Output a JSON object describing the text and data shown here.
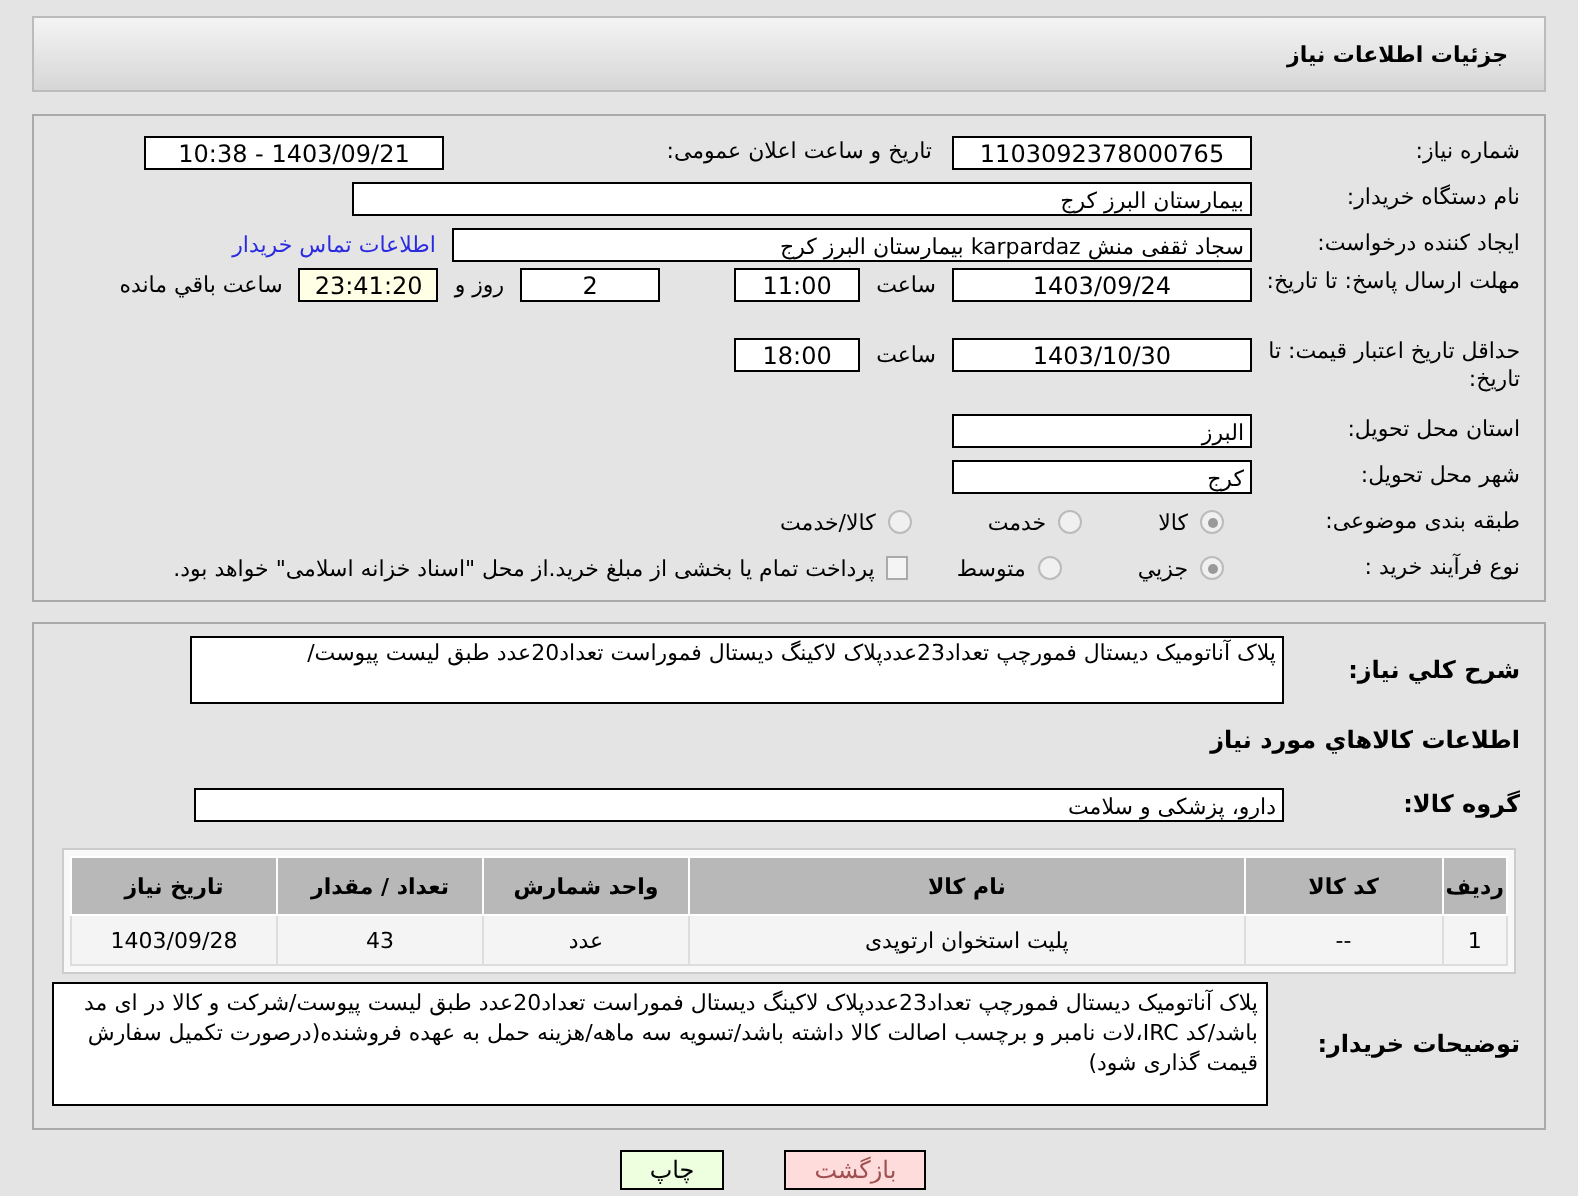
{
  "header": {
    "title": "جزئیات اطلاعات نیاز"
  },
  "need_number": {
    "label": "شماره نیاز:",
    "value": "1103092378000765"
  },
  "announce": {
    "label": "تاریخ و ساعت اعلان عمومی:",
    "value": "1403/09/21 - 10:38"
  },
  "buyer_org": {
    "label": "نام دستگاه خریدار:",
    "value": "بیمارستان البرز کرج"
  },
  "requester": {
    "label": "ایجاد کننده درخواست:",
    "value": "سجاد ثقفی منش karpardaz بیمارستان البرز کرج",
    "link": "اطلاعات تماس خریدار"
  },
  "reply_deadline": {
    "label": "مهلت ارسال پاسخ: تا تاریخ:",
    "date": "1403/09/24",
    "time_label": "ساعت",
    "time": "11:00",
    "days": "2",
    "days_label": "روز و",
    "remaining": "23:41:20",
    "remaining_label": "ساعت باقي مانده"
  },
  "price_validity": {
    "label": "حداقل تاریخ اعتبار قیمت: تا تاریخ:",
    "date": "1403/10/30",
    "time_label": "ساعت",
    "time": "18:00"
  },
  "province": {
    "label": "استان محل تحویل:",
    "value": "البرز"
  },
  "city": {
    "label": "شهر محل تحویل:",
    "value": "کرج"
  },
  "category": {
    "label": "طبقه بندی موضوعی:",
    "options": [
      {
        "label": "کالا",
        "selected": true
      },
      {
        "label": "خدمت",
        "selected": false
      },
      {
        "label": "کالا/خدمت",
        "selected": false
      }
    ]
  },
  "purchase_type": {
    "label": "نوع فرآیند خرید :",
    "options": [
      {
        "label": "جزیي",
        "selected": true
      },
      {
        "label": "متوسط",
        "selected": false
      }
    ],
    "treasury": {
      "checked": false,
      "label": "پرداخت تمام یا بخشی از مبلغ خرید.از محل \"اسناد خزانه اسلامی\" خواهد بود."
    }
  },
  "description": {
    "label": "شرح کلي نياز:",
    "value": "پلاک آناتومیک دیستال فمورچپ تعداد23عددپلاک لاکینگ دیستال فموراست تعداد20عدد طبق لیست پیوست/"
  },
  "items_title": "اطلاعات کالاهاي مورد نياز",
  "goods_group": {
    "label": "گروه کالا:",
    "value": "دارو، پزشکی و سلامت"
  },
  "table": {
    "columns": [
      "ردیف",
      "کد کالا",
      "نام کالا",
      "واحد شمارش",
      "تعداد / مقدار",
      "تاریخ نیاز"
    ],
    "rows": [
      [
        "1",
        "--",
        "پلیت استخوان ارتوپدی",
        "عدد",
        "43",
        "1403/09/28"
      ]
    ]
  },
  "buyer_notes": {
    "label": "توضیحات خریدار:",
    "value": "پلاک آناتومیک دیستال فمورچپ تعداد23عددپلاک لاکینگ دیستال فموراست تعداد20عدد طبق لیست پیوست/شرکت و کالا در ای مد باشد/کد IRC،لات نامبر و برچسب اصالت کالا داشته باشد/تسویه سه ماهه/هزینه حمل به عهده فروشنده(درصورت تکمیل سفارش قیمت گذاری شود)"
  },
  "buttons": [
    {
      "label": "بازگشت",
      "kind": "back"
    },
    {
      "label": "چاپ",
      "kind": "print"
    }
  ]
}
